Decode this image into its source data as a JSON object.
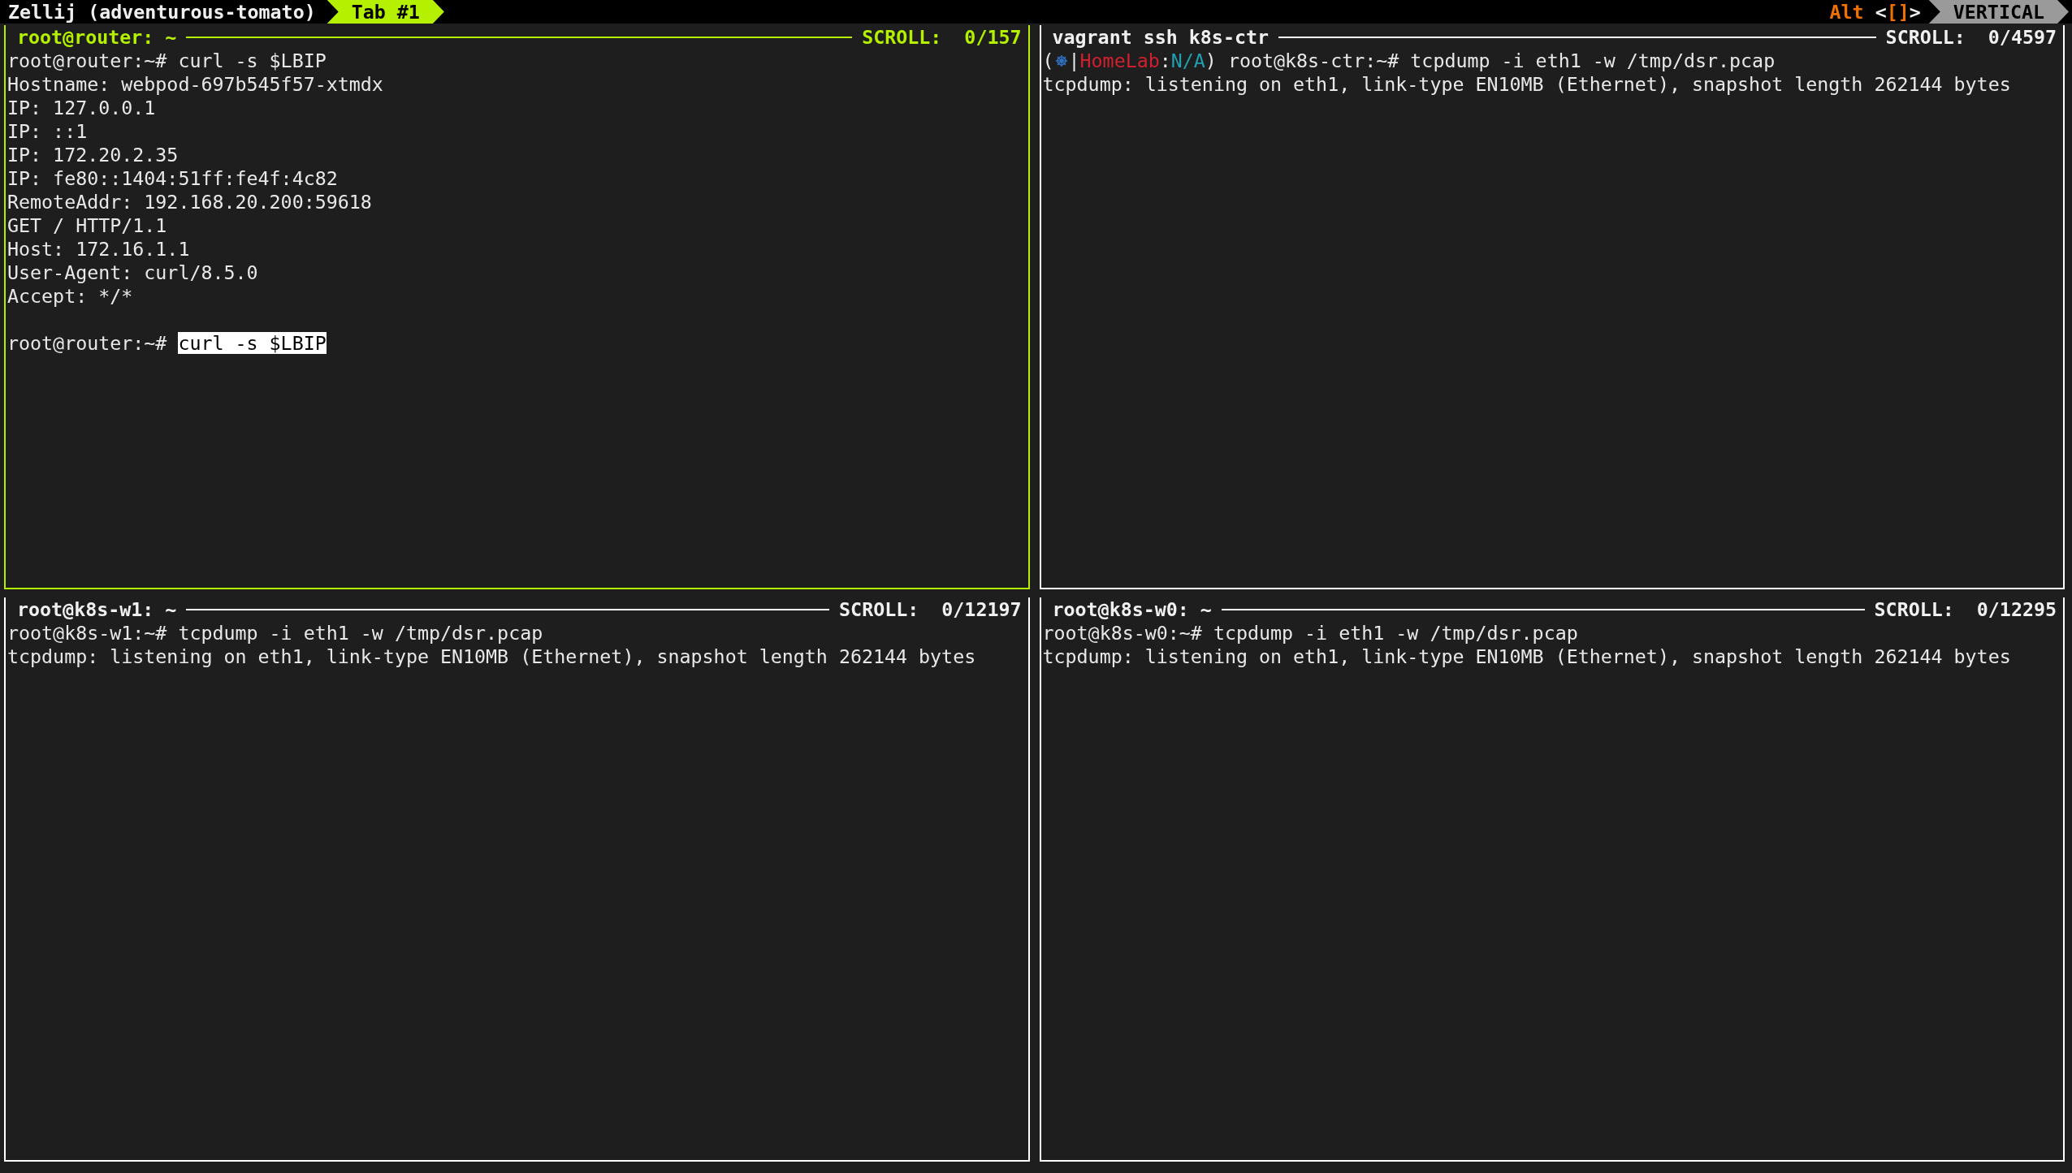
{
  "top_bar": {
    "session_title": "Zellij (adventurous-tomato)",
    "tabs": [
      {
        "label": "Tab #1",
        "selected": true
      }
    ],
    "mode": {
      "key": "Alt",
      "open": "<",
      "keys": "[]",
      "close": ">"
    },
    "swap_layout": "VERTICAL"
  },
  "panes": [
    {
      "title": "root@router: ~",
      "scroll": "SCROLL:  0/157",
      "focused": true,
      "lines": [
        {
          "kind": "text",
          "segments": [
            {
              "kind": "text",
              "text": "root@router:~# curl -s $LBIP"
            }
          ]
        },
        {
          "kind": "text",
          "segments": [
            {
              "kind": "text",
              "text": "Hostname: webpod-697b545f57-xtmdx"
            }
          ]
        },
        {
          "kind": "text",
          "segments": [
            {
              "kind": "text",
              "text": "IP: 127.0.0.1"
            }
          ]
        },
        {
          "kind": "text",
          "segments": [
            {
              "kind": "text",
              "text": "IP: ::1"
            }
          ]
        },
        {
          "kind": "text",
          "segments": [
            {
              "kind": "text",
              "text": "IP: 172.20.2.35"
            }
          ]
        },
        {
          "kind": "text",
          "segments": [
            {
              "kind": "text",
              "text": "IP: fe80::1404:51ff:fe4f:4c82"
            }
          ]
        },
        {
          "kind": "text",
          "segments": [
            {
              "kind": "text",
              "text": "RemoteAddr: 192.168.20.200:59618"
            }
          ]
        },
        {
          "kind": "text",
          "segments": [
            {
              "kind": "text",
              "text": "GET / HTTP/1.1"
            }
          ]
        },
        {
          "kind": "text",
          "segments": [
            {
              "kind": "text",
              "text": "Host: 172.16.1.1"
            }
          ]
        },
        {
          "kind": "text",
          "segments": [
            {
              "kind": "text",
              "text": "User-Agent: curl/8.5.0"
            }
          ]
        },
        {
          "kind": "text",
          "segments": [
            {
              "kind": "text",
              "text": "Accept: */*"
            }
          ]
        },
        {
          "kind": "blank"
        },
        {
          "kind": "text",
          "segments": [
            {
              "kind": "text",
              "text": "root@router:~# "
            },
            {
              "kind": "selected",
              "text": "curl -s $LBIP"
            }
          ]
        }
      ]
    },
    {
      "title": "vagrant ssh k8s-ctr",
      "scroll": "SCROLL:  0/4597",
      "focused": false,
      "lines": [
        {
          "kind": "text",
          "segments": [
            {
              "kind": "text",
              "text": "("
            },
            {
              "kind": "icon"
            },
            {
              "kind": "text",
              "text": "|"
            },
            {
              "kind": "cluster",
              "text": "HomeLab"
            },
            {
              "kind": "text",
              "text": ":"
            },
            {
              "kind": "namespace",
              "text": "N/A"
            },
            {
              "kind": "text",
              "text": ") root@k8s-ctr:~# tcpdump -i eth1 -w /tmp/dsr.pcap"
            }
          ]
        },
        {
          "kind": "text",
          "segments": [
            {
              "kind": "text",
              "text": "tcpdump: listening on eth1, link-type EN10MB (Ethernet), snapshot length 262144 bytes"
            }
          ]
        }
      ]
    },
    {
      "title": "root@k8s-w1: ~",
      "scroll": "SCROLL:  0/12197",
      "focused": false,
      "lines": [
        {
          "kind": "text",
          "segments": [
            {
              "kind": "text",
              "text": "root@k8s-w1:~# tcpdump -i eth1 -w /tmp/dsr.pcap"
            }
          ]
        },
        {
          "kind": "text",
          "segments": [
            {
              "kind": "text",
              "text": "tcpdump: listening on eth1, link-type EN10MB (Ethernet), snapshot length 262144 bytes"
            }
          ]
        }
      ]
    },
    {
      "title": "root@k8s-w0: ~",
      "scroll": "SCROLL:  0/12295",
      "focused": false,
      "lines": [
        {
          "kind": "text",
          "segments": [
            {
              "kind": "text",
              "text": "root@k8s-w0:~# tcpdump -i eth1 -w /tmp/dsr.pcap"
            }
          ]
        },
        {
          "kind": "text",
          "segments": [
            {
              "kind": "text",
              "text": "tcpdump: listening on eth1, link-type EN10MB (Ethernet), snapshot length 262144 bytes"
            }
          ]
        }
      ]
    }
  ]
}
